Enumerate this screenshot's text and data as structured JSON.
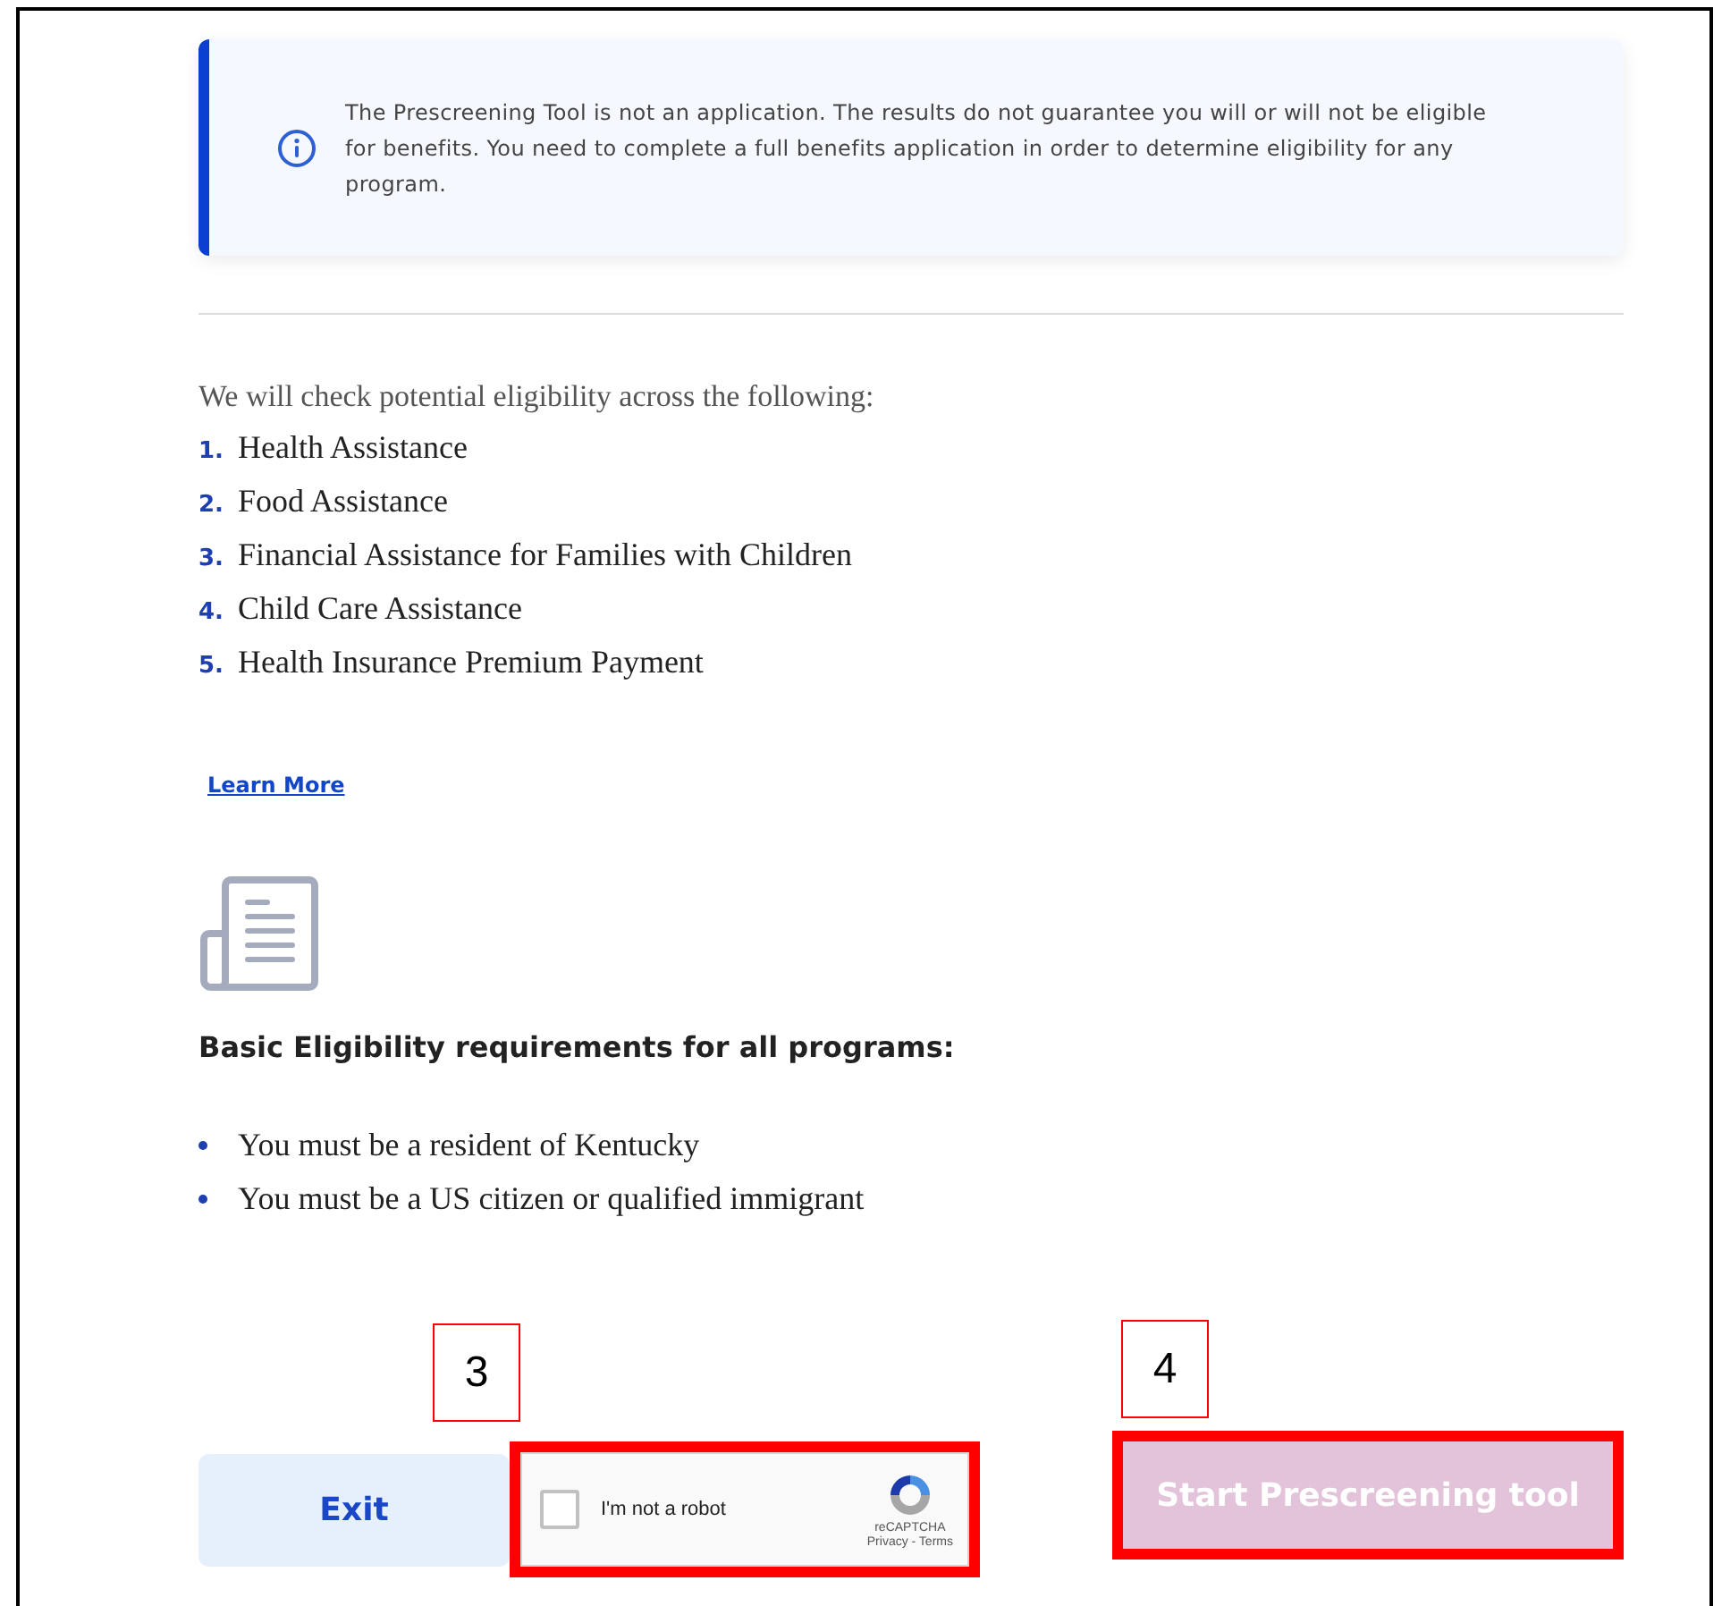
{
  "notice": {
    "text": "The Prescreening Tool is not an application. The results do not guarantee you will or will not be eligible for benefits. You need to complete a full benefits application in order to determine eligibility for any program."
  },
  "intro": "We will check potential eligibility across the following:",
  "programs": [
    {
      "number": "1.",
      "name": "Health Assistance"
    },
    {
      "number": "2.",
      "name": "Food Assistance"
    },
    {
      "number": "3.",
      "name": "Financial Assistance for Families with Children"
    },
    {
      "number": "4.",
      "name": "Child Care Assistance"
    },
    {
      "number": "5.",
      "name": "Health Insurance Premium Payment"
    }
  ],
  "learn_more": "Learn More",
  "requirements": {
    "heading": "Basic Eligibility requirements for all programs:",
    "items": [
      "You must be a resident of Kentucky",
      "You must be a US citizen or qualified immigrant"
    ]
  },
  "exit_button": "Exit",
  "captcha": {
    "label": "I'm not a robot",
    "checked": false,
    "brand": "reCAPTCHA",
    "links": "Privacy - Terms"
  },
  "start_button": {
    "label": "Start Prescreening tool",
    "disabled": true
  },
  "annotations": [
    {
      "label": "3"
    },
    {
      "label": "4"
    }
  ]
}
